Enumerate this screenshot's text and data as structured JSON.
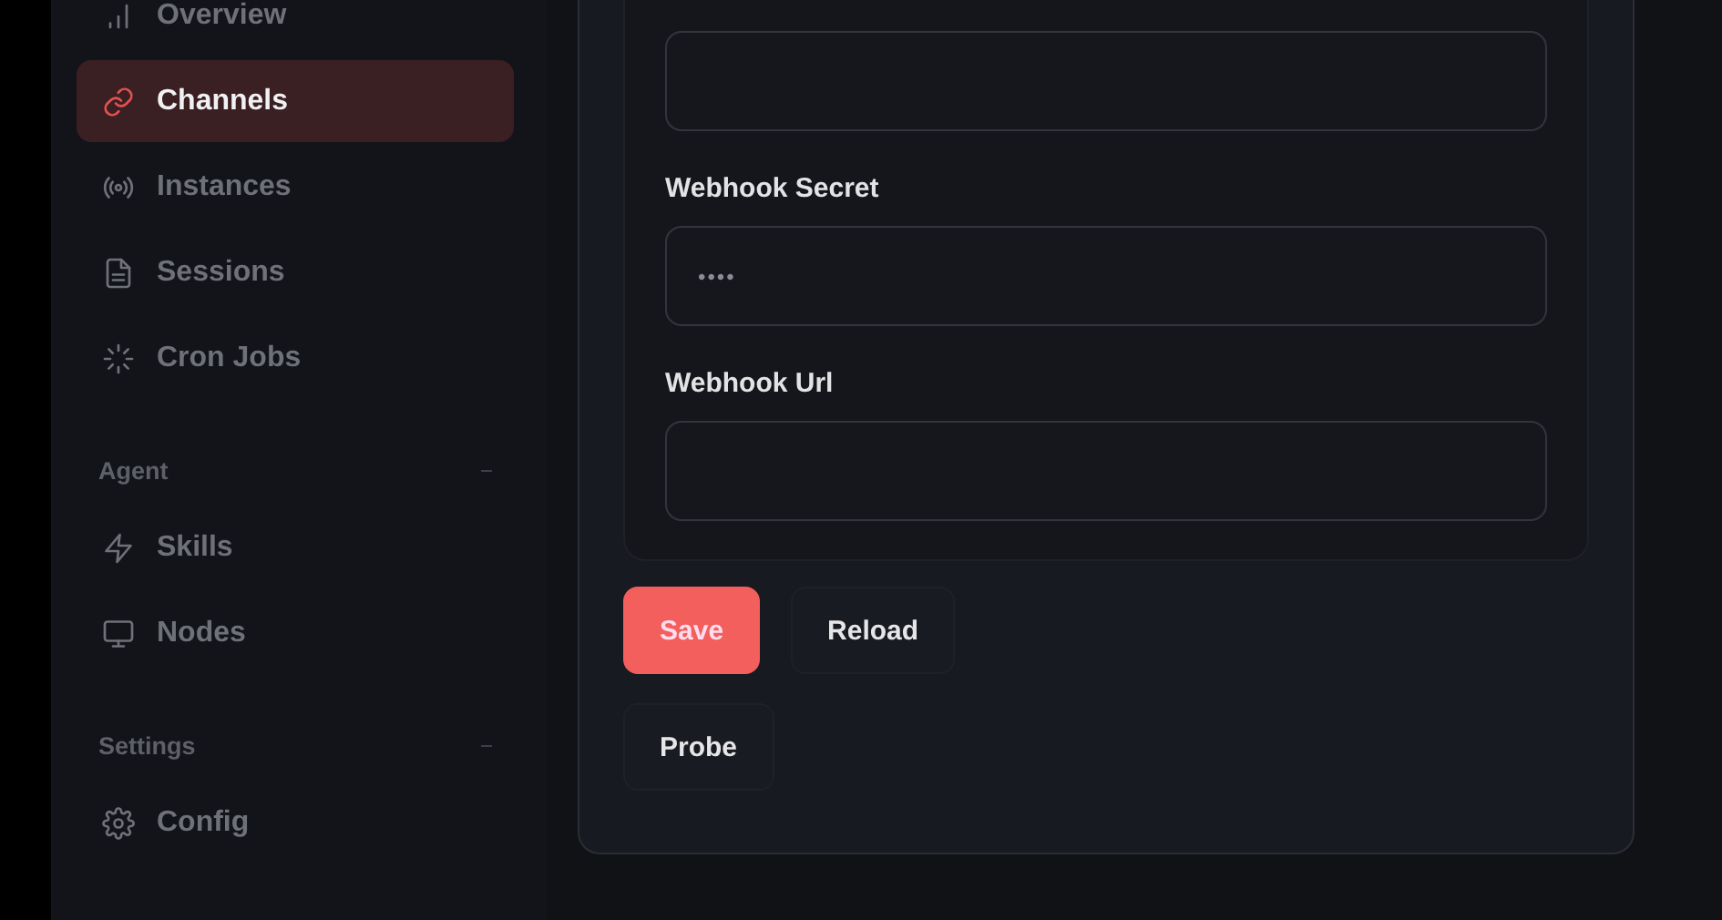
{
  "sidebar": {
    "sections": [
      {
        "items": [
          {
            "label": "Overview",
            "kind": "chart",
            "selected": false
          },
          {
            "label": "Channels",
            "kind": "link",
            "selected": true
          },
          {
            "label": "Instances",
            "kind": "radio",
            "selected": false
          },
          {
            "label": "Sessions",
            "kind": "file",
            "selected": false
          },
          {
            "label": "Cron Jobs",
            "kind": "loader",
            "selected": false
          }
        ]
      },
      {
        "title": "Agent",
        "items": [
          {
            "label": "Skills",
            "kind": "bolt",
            "selected": false
          },
          {
            "label": "Nodes",
            "kind": "monitor",
            "selected": false
          }
        ]
      },
      {
        "title": "Settings",
        "items": [
          {
            "label": "Config",
            "kind": "gear",
            "selected": false
          }
        ]
      }
    ]
  },
  "form": {
    "fields": [
      {
        "kind": "text"
      },
      {
        "label": "Webhook Secret",
        "kind": "password",
        "value": "••••"
      },
      {
        "label": "Webhook Url",
        "kind": "text"
      }
    ]
  },
  "buttons": [
    {
      "label": "Save",
      "kind": "primary"
    },
    {
      "label": "Reload",
      "kind": "secondary"
    },
    {
      "label": "Probe",
      "kind": "secondary"
    }
  ]
}
